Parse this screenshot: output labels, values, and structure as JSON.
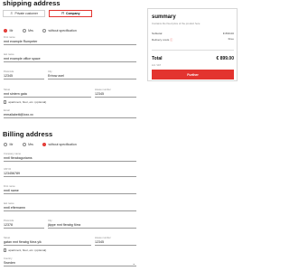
{
  "shipping": {
    "title": "shipping address",
    "customer_types": [
      {
        "label": "Private customer",
        "icon": "person-icon"
      },
      {
        "label": "Company",
        "icon": "building-icon"
      }
    ],
    "salutations": [
      "Mr",
      "Mrs",
      "without specification"
    ],
    "fields": {
      "first_name": {
        "label": "First name",
        "value": "mnt example Rumpeter"
      },
      "last_name": {
        "label": "last name",
        "value": "mnt example office space"
      },
      "postal_code": {
        "label": "Postcode",
        "value": "12345"
      },
      "city": {
        "label": "City",
        "value": "Ertrow axel"
      },
      "street": {
        "label": "Street",
        "value": "mnt sintern gata"
      },
      "house_number": {
        "label": "House number",
        "value": "12345"
      },
      "apartment_check": "apartment, floor, etc. (optional)",
      "email": {
        "label": "Email",
        "value": "ermailabeiti@ixxx.xx"
      }
    }
  },
  "billing": {
    "title": "Billing address",
    "salutations": [
      "Mr",
      "Mrs",
      "without specification"
    ],
    "fields": {
      "company": {
        "label": "Company name",
        "value": "mntl flerabagoriams"
      },
      "vat": {
        "label": "VAT ID",
        "value": "123456789"
      },
      "first_name": {
        "label": "First name",
        "value": "mntl name"
      },
      "last_name": {
        "label": "last name",
        "value": "mntl efternamn"
      },
      "postal_code": {
        "label": "Postcode",
        "value": "12378"
      },
      "city": {
        "label": "City",
        "value": "jäppe mnt flerabg förra"
      },
      "street": {
        "label": "Street",
        "value": "gatan mnt flerabg förra yik"
      },
      "house_number": {
        "label": "House number",
        "value": "12345"
      },
      "apartment_check": "apartment, floor, etc. (optional)",
      "country": {
        "label": "Country",
        "value": "Sweden"
      }
    }
  },
  "summary": {
    "title": "summary",
    "subtitle": "Contains the fixed price of the product here",
    "subtotal_label": "Subtotal",
    "subtotal_value": "€ 899.00",
    "delivery_label": "Delivery costs",
    "delivery_value": "Free",
    "total_label": "Total",
    "total_value": "€ 899.00",
    "total_note": "incl. VAT",
    "button_label": "Further"
  },
  "colors": {
    "accent": "#e3342f"
  }
}
